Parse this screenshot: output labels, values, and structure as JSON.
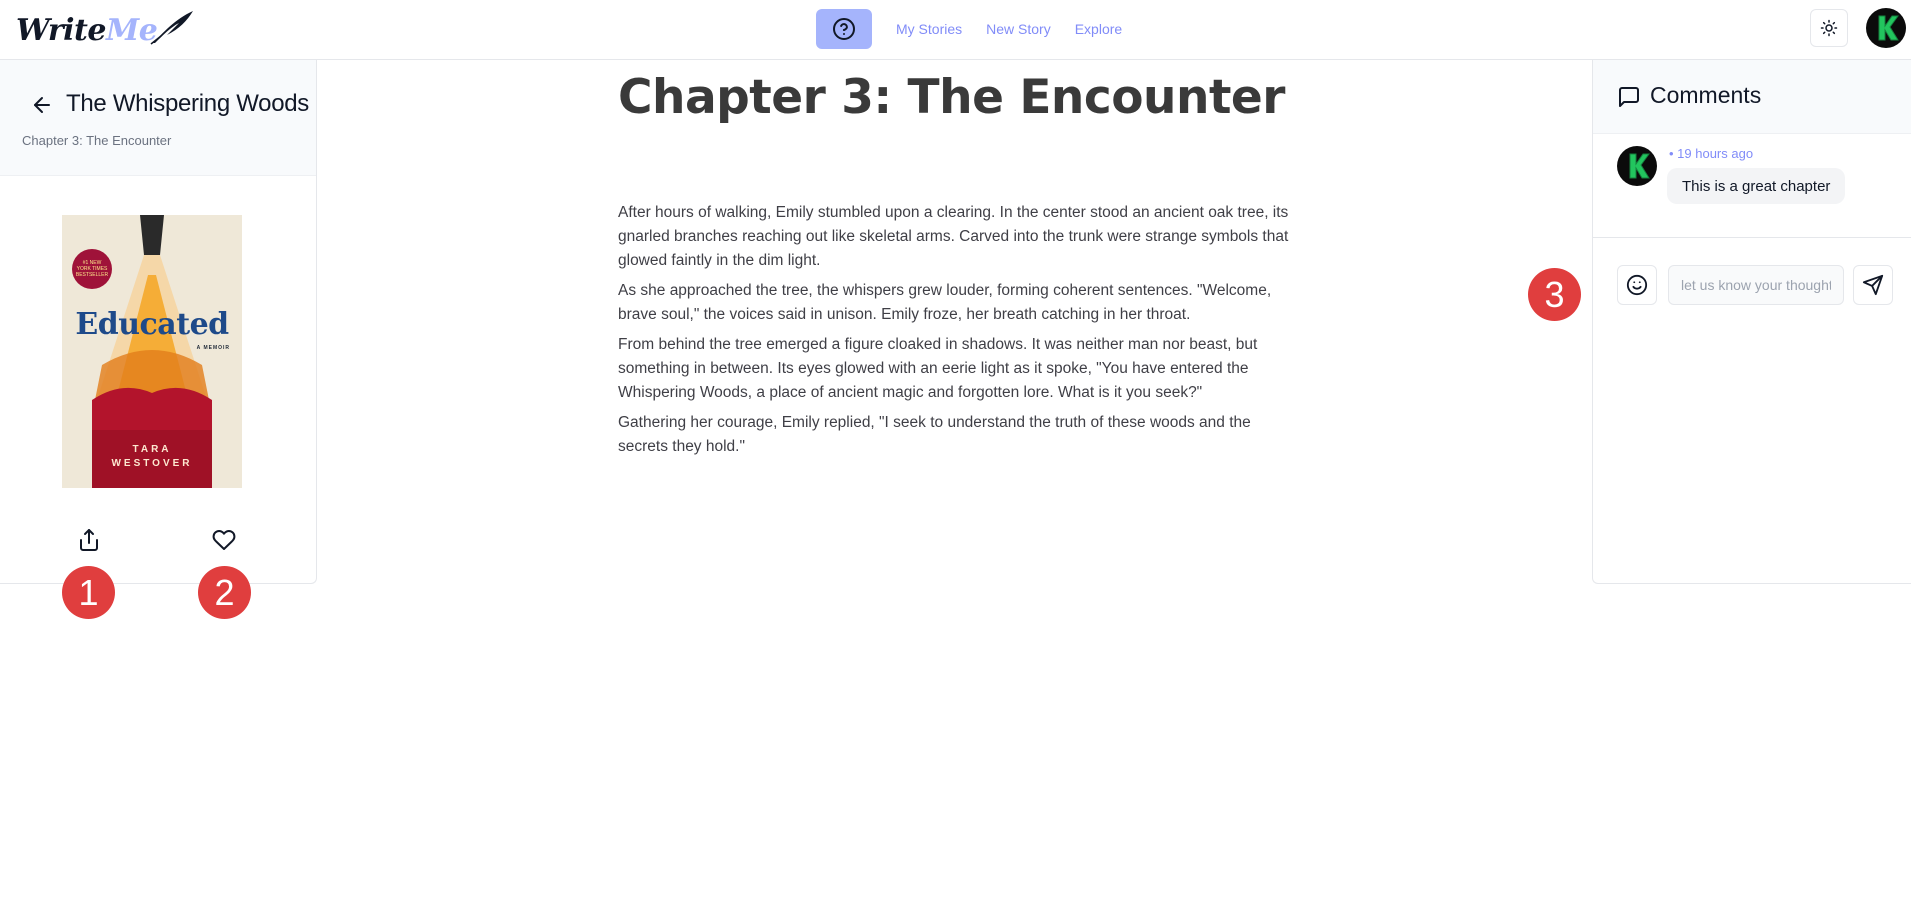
{
  "header": {
    "logo_write": "Write",
    "logo_me": "Me",
    "nav": [
      {
        "label": "My Stories"
      },
      {
        "label": "New Story"
      },
      {
        "label": "Explore"
      }
    ],
    "icons": {
      "help": "question-circle-icon",
      "theme": "sun-icon",
      "avatar": "user-avatar"
    }
  },
  "sidebar": {
    "story_title": "The Whispering Woods",
    "chapter_subtitle": "Chapter 3: The Encounter",
    "cover": {
      "badge": "#1 NEW YORK TIMES BESTSELLER",
      "title": "Educated",
      "subtitle": "A MEMOIR",
      "author_line1": "TARA",
      "author_line2": "WESTOVER"
    },
    "icons": {
      "back": "arrow-left-icon",
      "share": "share-icon",
      "like": "heart-icon"
    }
  },
  "chapter": {
    "heading": "Chapter 3: The Encounter",
    "paragraphs": [
      "After hours of walking, Emily stumbled upon a clearing. In the center stood an ancient oak tree, its gnarled branches reaching out like skeletal arms. Carved into the trunk were strange symbols that glowed faintly in the dim light.",
      "As she approached the tree, the whispers grew louder, forming coherent sentences. \"Welcome, brave soul,\" the voices said in unison. Emily froze, her breath catching in her throat.",
      "From behind the tree emerged a figure cloaked in shadows. It was neither man nor beast, but something in between. Its eyes glowed with an eerie light as it spoke, \"You have entered the Whispering Woods, a place of ancient magic and forgotten lore. What is it you seek?\"",
      "Gathering her courage, Emily replied, \"I seek to understand the truth of these woods and the secrets they hold.\""
    ]
  },
  "comments": {
    "title": "Comments",
    "items": [
      {
        "time": "• 19 hours ago",
        "text": "This is a great chapter"
      }
    ],
    "input_placeholder": "let us know your thoughts",
    "icons": {
      "header": "message-square-icon",
      "emoji": "smile-icon",
      "send": "send-icon"
    }
  },
  "markers": [
    "1",
    "2",
    "3"
  ],
  "colors": {
    "accent": "#818cf8",
    "accent_light": "#a5b4fc",
    "marker": "#e03e3e",
    "avatar_bg": "#0b0b0b",
    "avatar_letter": "#22c55e"
  }
}
